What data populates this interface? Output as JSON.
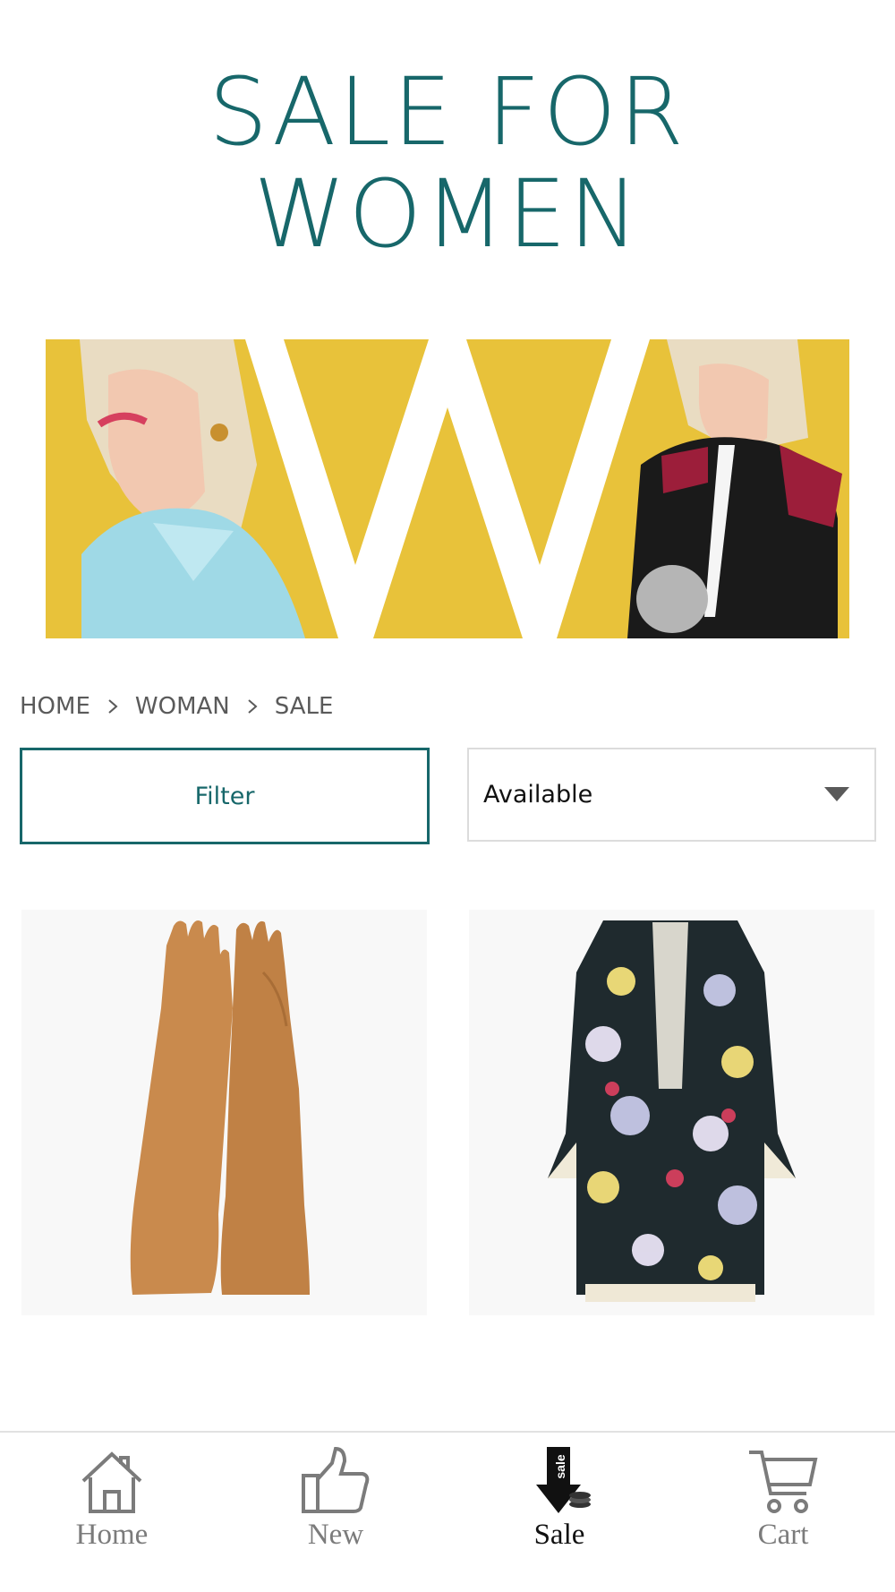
{
  "hero": {
    "title_line1": "SALE FOR",
    "title_line2": "WOMEN"
  },
  "breadcrumb": [
    "HOME",
    "WOMAN",
    "SALE"
  ],
  "controls": {
    "filter_label": "Filter",
    "availability_selected": "Available"
  },
  "products": [
    {
      "name": "long-suede-gloves",
      "color": "#c98a4d"
    },
    {
      "name": "floral-print-coat",
      "color": "#1f2a2e"
    }
  ],
  "nav": {
    "items": [
      {
        "label": "Home",
        "icon": "home-icon"
      },
      {
        "label": "New",
        "icon": "thumbs-up-icon"
      },
      {
        "label": "Sale",
        "icon": "sale-tag-icon",
        "active": true
      },
      {
        "label": "Cart",
        "icon": "cart-icon"
      }
    ]
  },
  "colors": {
    "accent": "#17676a",
    "banner_yellow": "#e8c23a",
    "nav_inactive": "#7b7b7b",
    "nav_active": "#111111"
  }
}
